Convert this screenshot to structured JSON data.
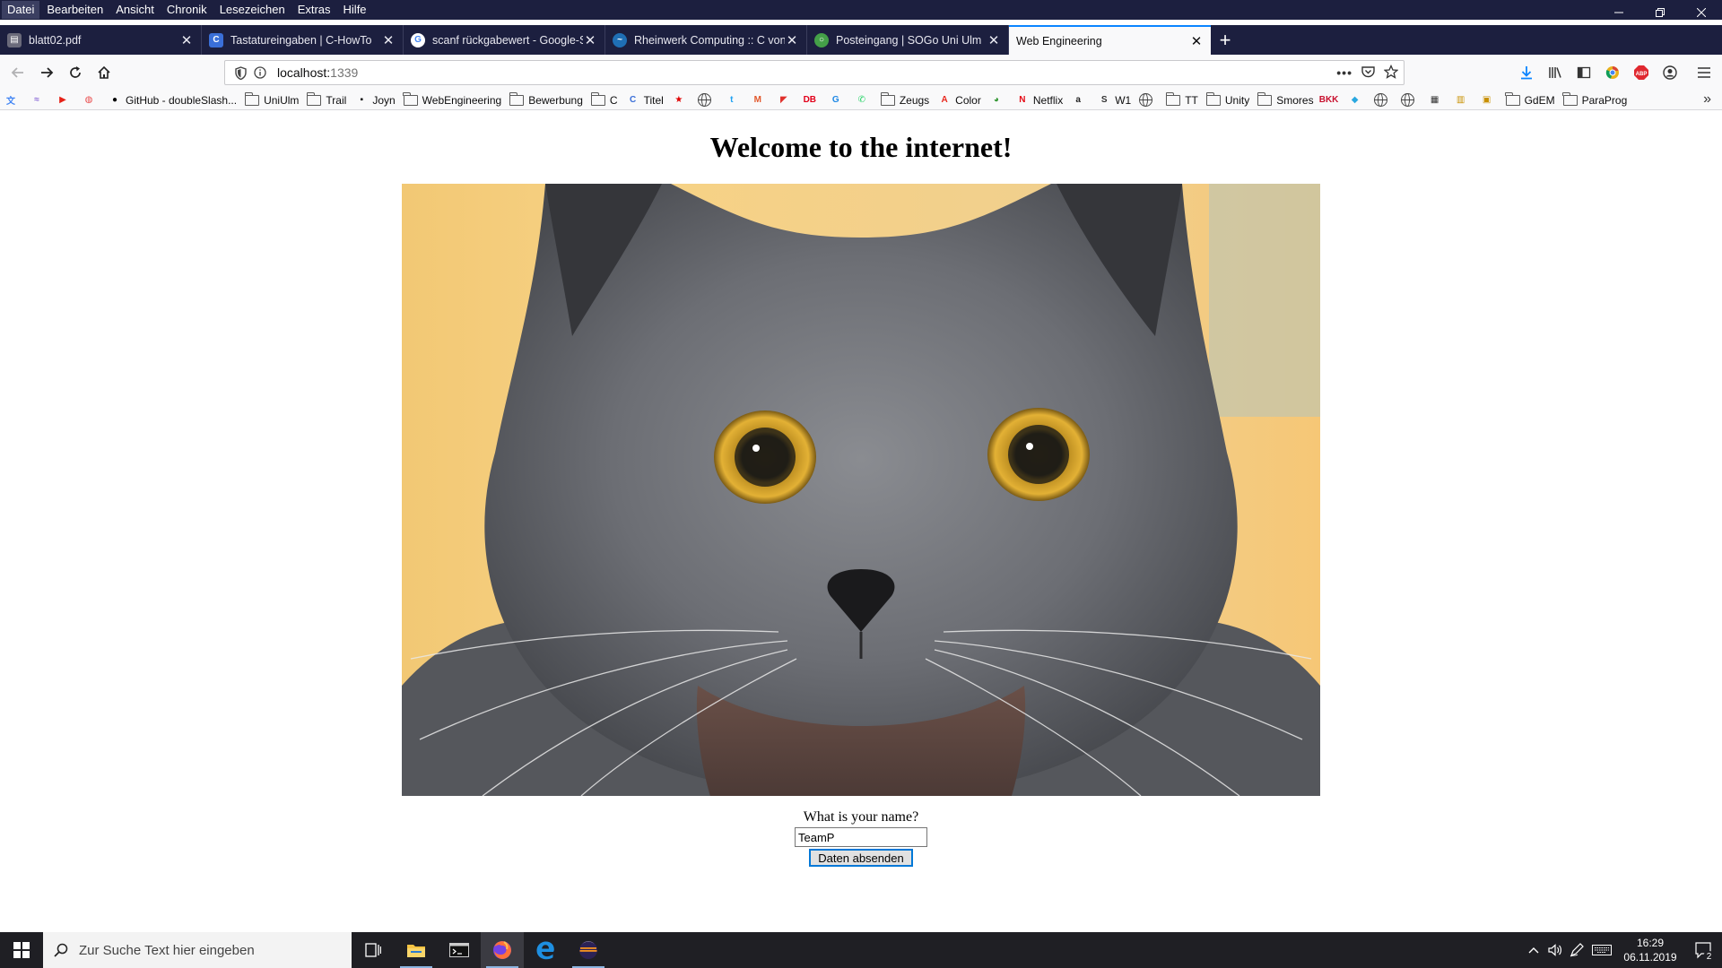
{
  "menubar": {
    "items": [
      "Datei",
      "Bearbeiten",
      "Ansicht",
      "Chronik",
      "Lesezeichen",
      "Extras",
      "Hilfe"
    ]
  },
  "tabs": [
    {
      "title": "blatt02.pdf",
      "icon": "pdf-icon",
      "color": "#5a5a6a"
    },
    {
      "title": "Tastatureingaben | C-HowTo",
      "icon": "c-howto-icon",
      "color": "#3a6fd8"
    },
    {
      "title": "scanf rückgabewert - Google-S",
      "icon": "google-icon",
      "color": "#4285f4"
    },
    {
      "title": "Rheinwerk Computing :: C von",
      "icon": "rheinwerk-icon",
      "color": "#1f6fb5"
    },
    {
      "title": "Posteingang | SOGo Uni Ulm",
      "icon": "sogo-icon",
      "color": "#44a048"
    },
    {
      "title": "Web Engineering",
      "icon": "",
      "color": ""
    }
  ],
  "navbar": {
    "url_host": "localhost:",
    "url_port": "1339"
  },
  "bookmarks": [
    {
      "label": "",
      "type": "icon",
      "icon": "translate-icon",
      "color": "#4285f4"
    },
    {
      "label": "",
      "type": "icon",
      "icon": "wave-icon",
      "color": "#8a6ad6"
    },
    {
      "label": "",
      "type": "icon",
      "icon": "youtube-icon",
      "color": "#e62117"
    },
    {
      "label": "",
      "type": "icon",
      "icon": "red-logo-icon",
      "color": "#e94b4b"
    },
    {
      "label": "GitHub - doubleSlash...",
      "type": "icon",
      "icon": "github-icon",
      "color": "#000000"
    },
    {
      "label": "UniUlm",
      "type": "folder"
    },
    {
      "label": "Trail",
      "type": "folder"
    },
    {
      "label": "Joyn",
      "type": "icon",
      "icon": "joyn-icon",
      "color": "#000000"
    },
    {
      "label": "WebEngineering",
      "type": "folder"
    },
    {
      "label": "Bewerbung",
      "type": "folder"
    },
    {
      "label": "C",
      "type": "folder"
    },
    {
      "label": "Titel",
      "type": "icon",
      "icon": "c-howto-icon",
      "color": "#3a6fd8"
    },
    {
      "label": "",
      "type": "icon",
      "icon": "star-icon",
      "color": "#e00000"
    },
    {
      "label": "",
      "type": "globe"
    },
    {
      "label": "",
      "type": "icon",
      "icon": "t-icon",
      "color": "#1da1f2"
    },
    {
      "label": "",
      "type": "icon",
      "icon": "mail-icon",
      "color": "#e2572b"
    },
    {
      "label": "",
      "type": "icon",
      "icon": "flag-icon",
      "color": "#e0302b"
    },
    {
      "label": "",
      "type": "icon",
      "icon": "db-icon",
      "color": "#e2001a"
    },
    {
      "label": "",
      "type": "icon",
      "icon": "g-icon",
      "color": "#1e88e5"
    },
    {
      "label": "",
      "type": "icon",
      "icon": "whatsapp-icon",
      "color": "#25d366"
    },
    {
      "label": "Zeugs",
      "type": "folder"
    },
    {
      "label": "Color",
      "type": "icon",
      "icon": "adobe-icon",
      "color": "#e8281e"
    },
    {
      "label": "",
      "type": "icon",
      "icon": "frog-icon",
      "color": "#3a9a3a"
    },
    {
      "label": "Netflix",
      "type": "icon",
      "icon": "netflix-icon",
      "color": "#e50914"
    },
    {
      "label": "",
      "type": "icon",
      "icon": "amazon-icon",
      "color": "#222222"
    },
    {
      "label": "W1",
      "type": "icon",
      "icon": "w1-icon",
      "color": "#333333"
    },
    {
      "label": "",
      "type": "globe"
    },
    {
      "label": "TT",
      "type": "folder"
    },
    {
      "label": "Unity",
      "type": "folder"
    },
    {
      "label": "Smores",
      "type": "folder"
    },
    {
      "label": "",
      "type": "icon",
      "icon": "bkk-icon",
      "color": "#c8102e"
    },
    {
      "label": "",
      "type": "icon",
      "icon": "slack-icon",
      "color": "#2aa8e0"
    },
    {
      "label": "",
      "type": "globe"
    },
    {
      "label": "",
      "type": "globe"
    },
    {
      "label": "",
      "type": "icon",
      "icon": "grid-icon",
      "color": "#333333"
    },
    {
      "label": "",
      "type": "icon",
      "icon": "building-icon",
      "color": "#c89000"
    },
    {
      "label": "",
      "type": "icon",
      "icon": "bank-icon",
      "color": "#c89000"
    },
    {
      "label": "GdEM",
      "type": "folder"
    },
    {
      "label": "ParaProg",
      "type": "folder"
    }
  ],
  "page": {
    "title": "Welcome to the internet!",
    "image": "grey-cat-photo",
    "form_label": "What is your name?",
    "name_value": "TeamP",
    "submit_label": "Daten absenden"
  },
  "taskbar": {
    "search_placeholder": "Zur Suche Text hier eingeben",
    "time": "16:29",
    "date": "06.11.2019",
    "notifications": "2"
  },
  "colors": {
    "titlebar": "#1c1f3f",
    "selected_tab_accent": "#0a84ff",
    "taskbar": "#1f1f24"
  }
}
